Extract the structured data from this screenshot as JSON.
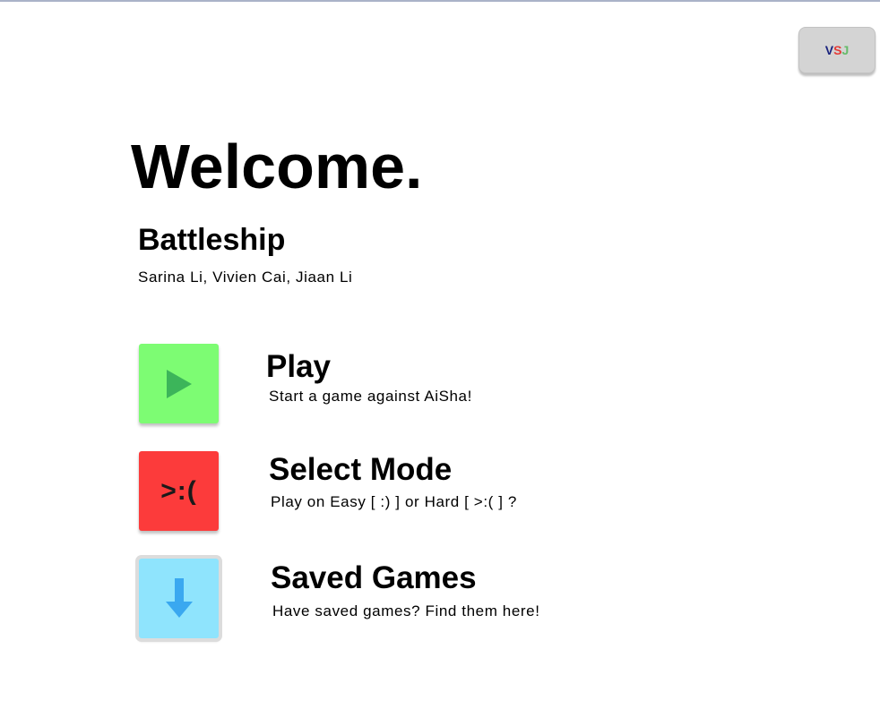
{
  "logo": {
    "letters": [
      {
        "char": "V",
        "color": "#1a237e"
      },
      {
        "char": "S",
        "color": "#e53935"
      },
      {
        "char": "J",
        "color": "#66bb6a"
      }
    ]
  },
  "heading": "Welcome.",
  "app_title": "Battleship",
  "authors": "Sarina Li, Vivien Cai, Jiaan Li",
  "menu": [
    {
      "title": "Play",
      "description": "Start a game against AiSha!",
      "icon": "play-icon",
      "color": "#7dfc73"
    },
    {
      "title": "Select Mode",
      "description": "Play on Easy [ :) ] or Hard [ >:( ] ?",
      "icon": ">:(",
      "color": "#fc3b3b"
    },
    {
      "title": "Saved Games",
      "description": "Have saved games? Find them here!",
      "icon": "download-arrow-icon",
      "color": "#8fe4fd"
    }
  ]
}
